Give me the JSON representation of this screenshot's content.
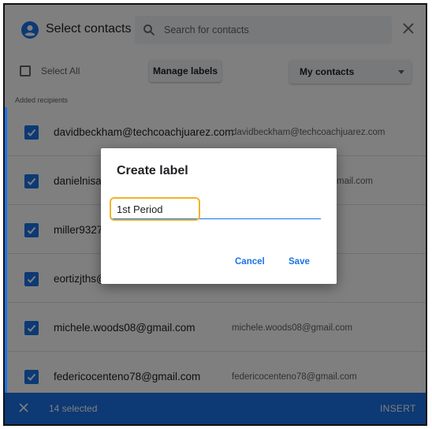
{
  "header": {
    "title": "Select contacts",
    "search_placeholder": "Search for contacts"
  },
  "toolbar": {
    "select_all_label": "Select All",
    "manage_labels_label": "Manage labels",
    "contacts_filter_value": "My contacts"
  },
  "section_label": "Added recipients",
  "contacts": [
    {
      "name": "davidbeckham@techcoachjuarez.com",
      "email": "davidbeckham@techcoachjuarez.com"
    },
    {
      "name": "danielnisa",
      "email": "mail.com"
    },
    {
      "name": "miller9327",
      "email": ""
    },
    {
      "name": "eortizjths@",
      "email": ""
    },
    {
      "name": "michele.woods08@gmail.com",
      "email": "michele.woods08@gmail.com"
    },
    {
      "name": "federicocenteno78@gmail.com",
      "email": "federicocenteno78@gmail.com"
    }
  ],
  "footer": {
    "selected_count": "14 selected",
    "insert_label": "INSERT"
  },
  "dialog": {
    "title": "Create label",
    "input_value": "1st Period",
    "cancel_label": "Cancel",
    "save_label": "Save"
  },
  "colors": {
    "accent": "#1a73e8",
    "highlight": "#f0b429"
  }
}
